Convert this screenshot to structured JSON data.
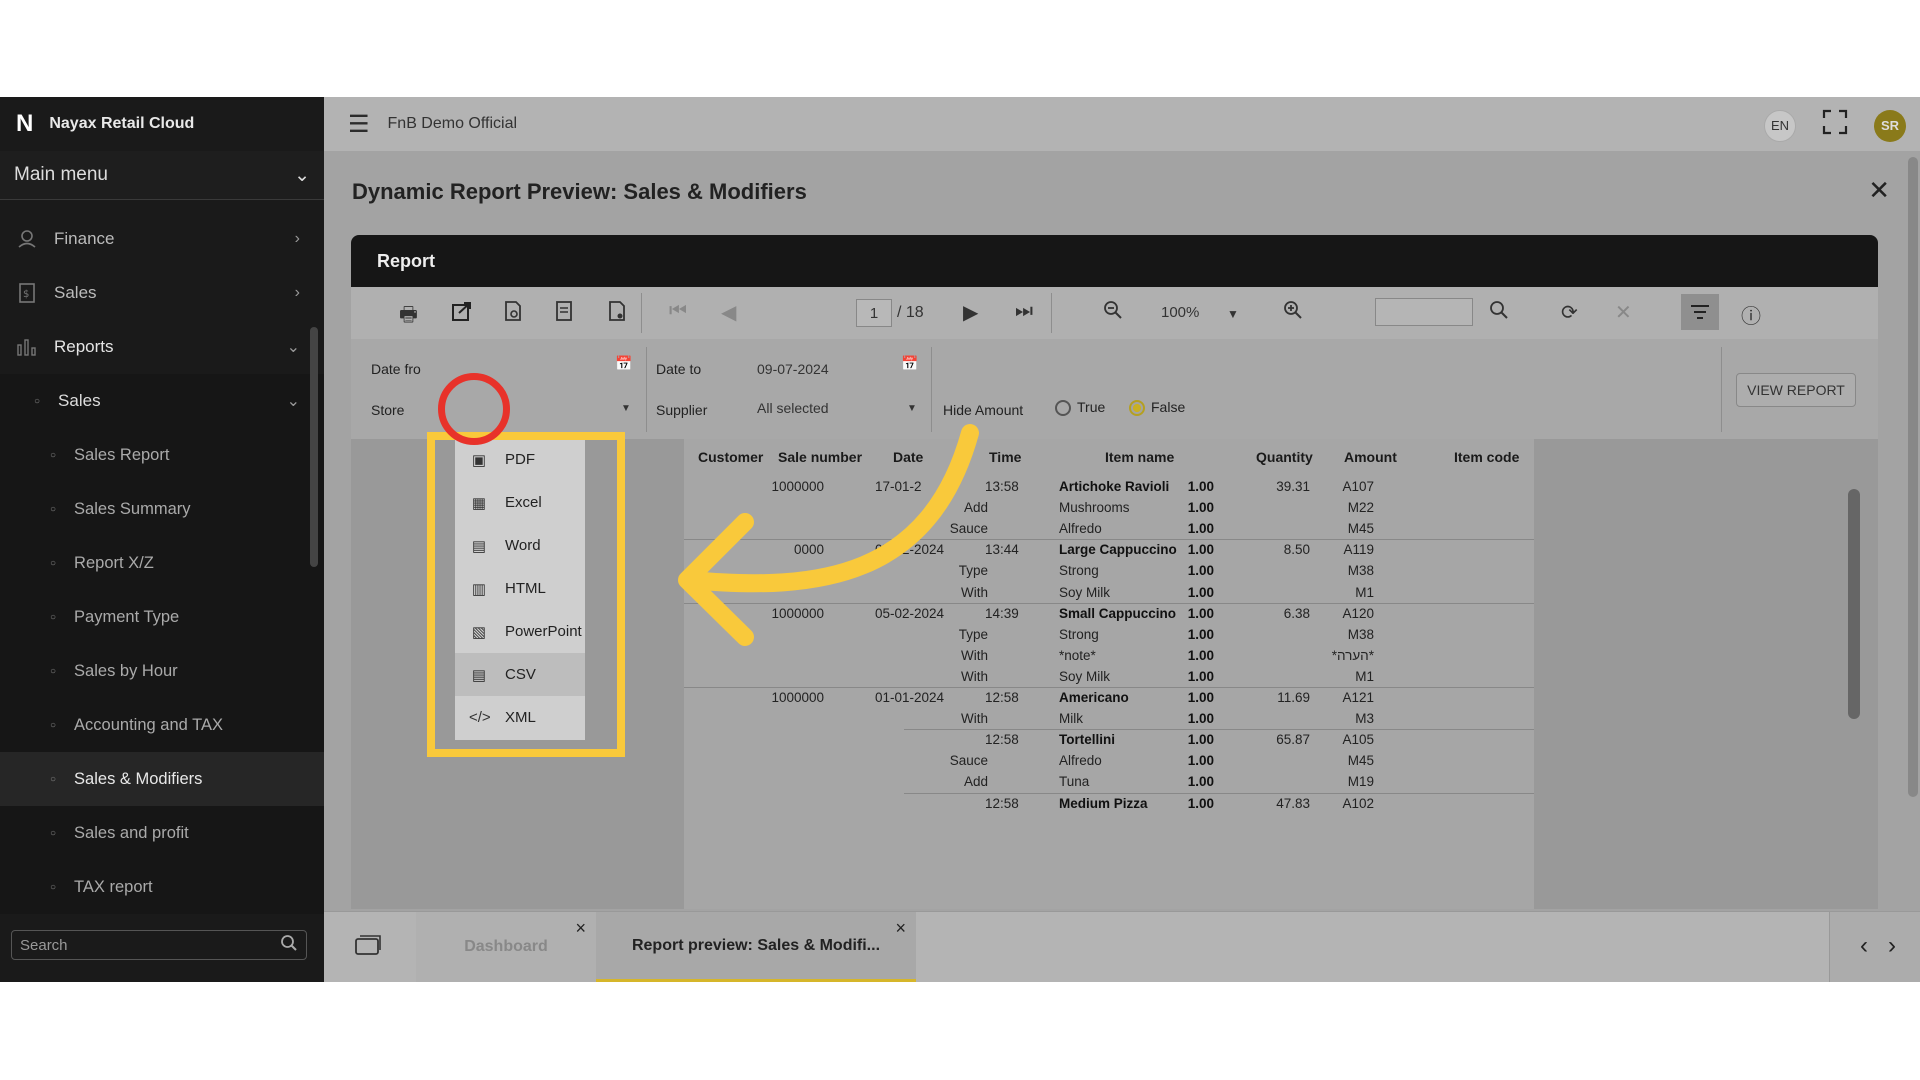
{
  "sidebar": {
    "brand_logo": "N",
    "brand": "Nayax Retail Cloud",
    "main_menu": "Main menu",
    "items": [
      {
        "label": "Finance",
        "icon": "finance-icon"
      },
      {
        "label": "Sales",
        "icon": "sales-icon"
      },
      {
        "label": "Reports",
        "icon": "reports-icon"
      }
    ],
    "sub_sales": "Sales",
    "sub_items": [
      "Sales Report",
      "Sales Summary",
      "Report X/Z",
      "Payment Type",
      "Sales by Hour",
      "Accounting and TAX",
      "Sales & Modifiers",
      "Sales and profit",
      "TAX report"
    ],
    "active_item": "Sales & Modifiers",
    "search_placeholder": "Search"
  },
  "topbar": {
    "org": "FnB Demo Official",
    "lang": "EN",
    "avatar": "SR"
  },
  "page": {
    "title": "Dynamic Report Preview: Sales & Modifiers",
    "report_header": "Report"
  },
  "toolbar": {
    "page": "1",
    "page_total": "/ 18",
    "zoom": "100%"
  },
  "params": {
    "date_from_label": "Date fro",
    "date_to_label": "Date to",
    "date_to_value": "09-07-2024",
    "store_label": "Store",
    "supplier_label": "Supplier",
    "supplier_value": "All selected",
    "hide_amount_label": "Hide Amount",
    "true_label": "True",
    "false_label": "False",
    "view_report": "VIEW REPORT"
  },
  "table": {
    "headers": [
      "Customer",
      "Sale number",
      "Date",
      "Time",
      "Item name",
      "Quantity",
      "Amount",
      "Item code"
    ],
    "rows": [
      {
        "sale": "1000000",
        "date": "17-01-2",
        "time": "13:58",
        "prefix": "",
        "item": "Artichoke Ravioli",
        "qty": "1.00",
        "amount": "39.31",
        "code": "A107",
        "bold": true
      },
      {
        "sale": "",
        "date": "",
        "time": "",
        "prefix": "Add",
        "item": "Mushrooms",
        "qty": "1.00",
        "amount": "",
        "code": "M22",
        "bold": false
      },
      {
        "sale": "",
        "date": "",
        "time": "",
        "prefix": "Sauce",
        "item": "Alfredo",
        "qty": "1.00",
        "amount": "",
        "code": "M45",
        "bold": false
      },
      {
        "sale": "0000",
        "date": "05-02-2024",
        "time": "13:44",
        "prefix": "",
        "item": "Large Cappuccino",
        "qty": "1.00",
        "amount": "8.50",
        "code": "A119",
        "bold": true
      },
      {
        "sale": "",
        "date": "",
        "time": "",
        "prefix": "Type",
        "item": "Strong",
        "qty": "1.00",
        "amount": "",
        "code": "M38",
        "bold": false
      },
      {
        "sale": "",
        "date": "",
        "time": "",
        "prefix": "With",
        "item": "Soy Milk",
        "qty": "1.00",
        "amount": "",
        "code": "M1",
        "bold": false
      },
      {
        "sale": "1000000",
        "date": "05-02-2024",
        "time": "14:39",
        "prefix": "",
        "item": "Small Cappuccino",
        "qty": "1.00",
        "amount": "6.38",
        "code": "A120",
        "bold": true
      },
      {
        "sale": "",
        "date": "",
        "time": "",
        "prefix": "Type",
        "item": "Strong",
        "qty": "1.00",
        "amount": "",
        "code": "M38",
        "bold": false
      },
      {
        "sale": "",
        "date": "",
        "time": "",
        "prefix": "With",
        "item": "*note*",
        "qty": "1.00",
        "amount": "",
        "code": "*הערה*",
        "bold": false
      },
      {
        "sale": "",
        "date": "",
        "time": "",
        "prefix": "With",
        "item": "Soy Milk",
        "qty": "1.00",
        "amount": "",
        "code": "M1",
        "bold": false
      },
      {
        "sale": "1000000",
        "date": "01-01-2024",
        "time": "12:58",
        "prefix": "",
        "item": "Americano",
        "qty": "1.00",
        "amount": "11.69",
        "code": "A121",
        "bold": true
      },
      {
        "sale": "",
        "date": "",
        "time": "",
        "prefix": "With",
        "item": "Milk",
        "qty": "1.00",
        "amount": "",
        "code": "M3",
        "bold": false
      },
      {
        "sale": "",
        "date": "",
        "time": "12:58",
        "prefix": "",
        "item": "Tortellini",
        "qty": "1.00",
        "amount": "65.87",
        "code": "A105",
        "bold": true
      },
      {
        "sale": "",
        "date": "",
        "time": "",
        "prefix": "Sauce",
        "item": "Alfredo",
        "qty": "1.00",
        "amount": "",
        "code": "M45",
        "bold": false
      },
      {
        "sale": "",
        "date": "",
        "time": "",
        "prefix": "Add",
        "item": "Tuna",
        "qty": "1.00",
        "amount": "",
        "code": "M19",
        "bold": false
      },
      {
        "sale": "",
        "date": "",
        "time": "12:58",
        "prefix": "",
        "item": "Medium Pizza",
        "qty": "1.00",
        "amount": "47.83",
        "code": "A102",
        "bold": true
      }
    ]
  },
  "export_menu": {
    "items": [
      {
        "label": "PDF",
        "icon": "pdf-icon",
        "glyph": "▣"
      },
      {
        "label": "Excel",
        "icon": "excel-icon",
        "glyph": "▦"
      },
      {
        "label": "Word",
        "icon": "word-icon",
        "glyph": "▤"
      },
      {
        "label": "HTML",
        "icon": "html-icon",
        "glyph": "▥"
      },
      {
        "label": "PowerPoint",
        "icon": "powerpoint-icon",
        "glyph": "▧"
      },
      {
        "label": "CSV",
        "icon": "csv-icon",
        "glyph": "▤"
      },
      {
        "label": "XML",
        "icon": "xml-icon",
        "glyph": "</>"
      }
    ],
    "highlighted": "CSV"
  },
  "tabs": [
    {
      "label": "Dashboard",
      "active": false
    },
    {
      "label": "Report preview: Sales & Modifi...",
      "active": true
    }
  ],
  "colors": {
    "accent": "#f9c93b",
    "circle": "#e8322a",
    "sidebar": "#1a1a1a"
  }
}
